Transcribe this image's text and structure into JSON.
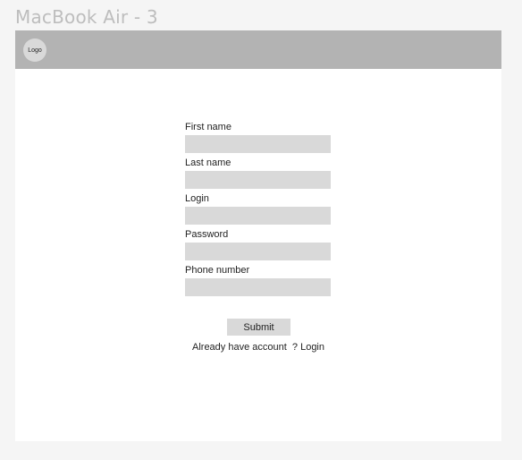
{
  "frame": {
    "title": "MacBook Air - 3"
  },
  "header": {
    "logo_text": "Logo"
  },
  "form": {
    "fields": [
      {
        "label": "First name",
        "value": ""
      },
      {
        "label": "Last name",
        "value": ""
      },
      {
        "label": "Login",
        "value": ""
      },
      {
        "label": "Password",
        "value": ""
      },
      {
        "label": "Phone number",
        "value": ""
      }
    ],
    "submit_label": "Submit",
    "account_prompt": "Already have account  ? ",
    "login_link": "Login"
  }
}
